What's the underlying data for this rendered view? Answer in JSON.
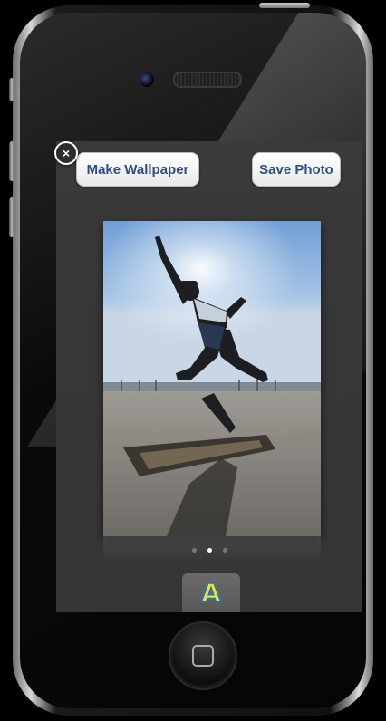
{
  "toolbar": {
    "close_glyph": "×",
    "make_wallpaper_label": "Make Wallpaper",
    "save_photo_label": "Save Photo"
  },
  "photo": {
    "subject": "skateboarder-kickflip",
    "sky_color": "#8fb6df",
    "ground_color": "#a9a39a"
  },
  "pager": {
    "pages": 3,
    "current_page": 2
  },
  "tabbar": {
    "tab_glyph": "A",
    "tab_icon": "letter-a-icon"
  },
  "device": {
    "home_icon": "home-button-icon",
    "accent": "#2e4f84"
  }
}
